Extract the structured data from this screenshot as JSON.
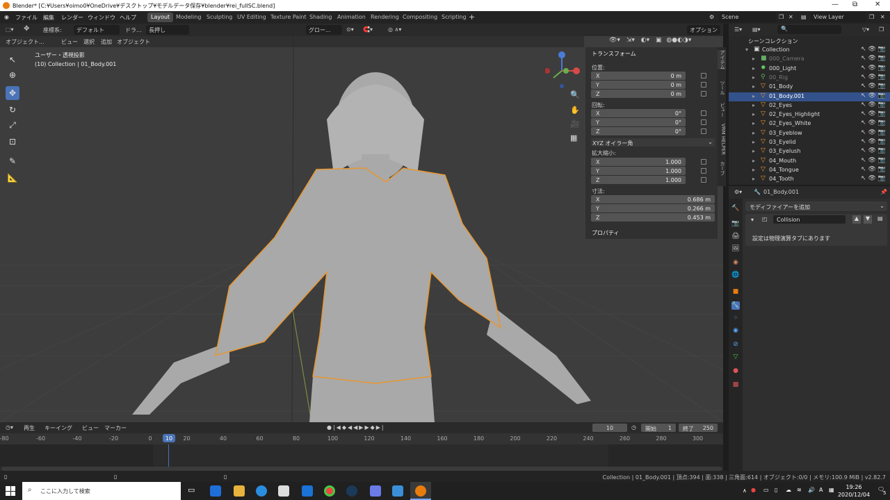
{
  "titlebar": {
    "title": "Blender* [C:¥Users¥oimo0¥OneDrive¥デスクトップ¥モデルデータ保存¥blender¥rei_fullSC.blend]",
    "min": "—",
    "max": "⧉",
    "close": "✕"
  },
  "menu": [
    "ファイル",
    "編集",
    "レンダー",
    "ウィンドウ",
    "ヘルプ"
  ],
  "workspaces": [
    "Layout",
    "Modeling",
    "Sculpting",
    "UV Editing",
    "Texture Paint",
    "Shading",
    "Animation",
    "Rendering",
    "Compositing",
    "Scripting"
  ],
  "active_workspace": "Layout",
  "scene": {
    "name": "Scene",
    "view_layer": "View Layer"
  },
  "viewport_header": {
    "coord_label": "座標系:",
    "coord_value": "デフォルト",
    "drag_label": "ドラ...",
    "drag_value": "長押し",
    "transform_orient": "グロー...",
    "options": "オプション"
  },
  "mode_header": {
    "mode": "オブジェクト...",
    "view": "ビュー",
    "select": "選択",
    "add": "追加",
    "object": "オブジェクト"
  },
  "viewport_overlay": {
    "view_name": "ユーザー・透視投影",
    "collection_info": "(10) Collection | 01_Body.001"
  },
  "npanel": {
    "transform_title": "トランスフォーム",
    "location_label": "位置:",
    "location": [
      {
        "axis": "X",
        "value": "0 m"
      },
      {
        "axis": "Y",
        "value": "0 m"
      },
      {
        "axis": "Z",
        "value": "0 m"
      }
    ],
    "rotation_label": "回転:",
    "rotation": [
      {
        "axis": "X",
        "value": "0°"
      },
      {
        "axis": "Y",
        "value": "0°"
      },
      {
        "axis": "Z",
        "value": "0°"
      }
    ],
    "euler_mode": "XYZ オイラー角",
    "scale_label": "拡大縮小:",
    "scale": [
      {
        "axis": "X",
        "value": "1.000"
      },
      {
        "axis": "Y",
        "value": "1.000"
      },
      {
        "axis": "Z",
        "value": "1.000"
      }
    ],
    "dimensions_label": "寸法:",
    "dimensions": [
      {
        "axis": "X",
        "value": "0.686 m"
      },
      {
        "axis": "Y",
        "value": "0.266 m"
      },
      {
        "axis": "Z",
        "value": "0.453 m"
      }
    ],
    "properties_title": "プロパティ"
  },
  "npanel_tabs": [
    "アイテム",
    "ツール",
    "ビュー",
    "VRM HELPER",
    "カーブ"
  ],
  "outliner": {
    "scene_collection": "シーンコレクション",
    "items": [
      {
        "name": "Collection",
        "kind": "collection",
        "selected": false,
        "dim": false
      },
      {
        "name": "000_Camera",
        "kind": "camera",
        "selected": false,
        "dim": true
      },
      {
        "name": "000_Light",
        "kind": "light",
        "selected": false,
        "dim": false
      },
      {
        "name": "00_Rig",
        "kind": "armature",
        "selected": false,
        "dim": true
      },
      {
        "name": "01_Body",
        "kind": "mesh",
        "selected": false,
        "dim": false
      },
      {
        "name": "01_Body.001",
        "kind": "mesh",
        "selected": true,
        "dim": false
      },
      {
        "name": "02_Eyes",
        "kind": "mesh",
        "selected": false,
        "dim": false
      },
      {
        "name": "02_Eyes_Highlight",
        "kind": "mesh",
        "selected": false,
        "dim": false
      },
      {
        "name": "02_Eyes_White",
        "kind": "mesh",
        "selected": false,
        "dim": false
      },
      {
        "name": "03_Eyeblow",
        "kind": "mesh",
        "selected": false,
        "dim": false
      },
      {
        "name": "03_Eyelid",
        "kind": "mesh",
        "selected": false,
        "dim": false
      },
      {
        "name": "03_Eyelush",
        "kind": "mesh",
        "selected": false,
        "dim": false
      },
      {
        "name": "04_Mouth",
        "kind": "mesh",
        "selected": false,
        "dim": false
      },
      {
        "name": "04_Tongue",
        "kind": "mesh",
        "selected": false,
        "dim": false
      },
      {
        "name": "04_Tooth",
        "kind": "mesh",
        "selected": false,
        "dim": false
      }
    ]
  },
  "properties": {
    "object_name": "01_Body.001",
    "add_modifier": "モディファイアーを追加",
    "modifier_name": "Collision",
    "modifier_note": "設定は物理演算タブにあります"
  },
  "timeline": {
    "playback": "再生",
    "keying": "キーイング",
    "view": "ビュー",
    "marker": "マーカー",
    "current_frame": "10",
    "start_label": "開始",
    "start": "1",
    "end_label": "終了",
    "end": "250",
    "ticks": [
      "-80",
      "-60",
      "-40",
      "-20",
      "0",
      "20",
      "40",
      "60",
      "80",
      "100",
      "120",
      "140",
      "160",
      "180",
      "200",
      "220",
      "240",
      "260",
      "280",
      "300"
    ],
    "playhead_label": "10"
  },
  "statusbar": {
    "text": "Collection | 01_Body.001 | 頂点:394 | 面:338 | 三角面:614 | オブジェクト:0/0 | メモリ:100.9 MiB | v2.82.7"
  },
  "taskbar": {
    "search_placeholder": "ここに入力して検索",
    "time": "19:26",
    "date": "2020/12/04",
    "notify_count": "5",
    "ime": "A"
  },
  "colors": {
    "accent": "#4a73b8",
    "selection_outline": "#e8962f",
    "active_row": "#33518a"
  }
}
